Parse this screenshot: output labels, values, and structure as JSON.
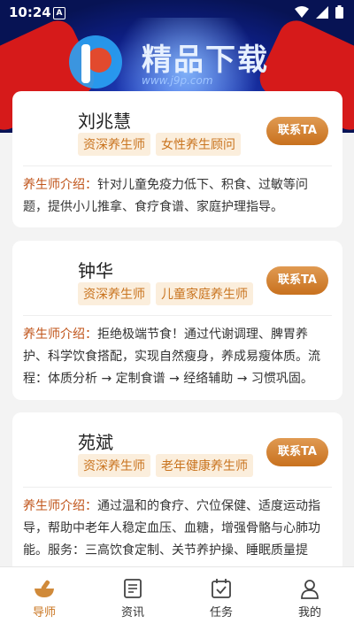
{
  "status": {
    "time": "10:24",
    "a_label": "A"
  },
  "watermark": {
    "text": "精品下载",
    "url": "www.j9p.com"
  },
  "advisors": [
    {
      "name": "刘兆慧",
      "tags": [
        "资深养生师",
        "女性养生顾问"
      ],
      "contact": "联系TA",
      "intro_label": "养生师介绍：",
      "intro": "针对儿童免疫力低下、积食、过敏等问题，提供小儿推拿、食疗食谱、家庭护理指导。"
    },
    {
      "name": "钟华",
      "tags": [
        "资深养生师",
        "儿童家庭养生师"
      ],
      "contact": "联系TA",
      "intro_label": "养生师介绍：",
      "intro": "拒绝极端节食！通过代谢调理、脾胃养护、科学饮食搭配，实现自然瘦身，养成易瘦体质。流程：体质分析 → 定制食谱 → 经络辅助 → 习惯巩固。"
    },
    {
      "name": "苑斌",
      "tags": [
        "资深养生师",
        "老年健康养生师"
      ],
      "contact": "联系TA",
      "intro_label": "养生师介绍：",
      "intro": "通过温和的食疗、穴位保健、适度运动指导，帮助中老年人稳定血压、血糖，增强骨骼与心肺功能。服务：三高饮食定制、关节养护操、睡眠质量提"
    }
  ],
  "tabs": [
    {
      "label": "导师",
      "icon": "mortar-icon",
      "active": true
    },
    {
      "label": "资讯",
      "icon": "news-icon",
      "active": false
    },
    {
      "label": "任务",
      "icon": "calendar-task-icon",
      "active": false
    },
    {
      "label": "我的",
      "icon": "user-icon",
      "active": false
    }
  ],
  "colors": {
    "accent": "#c9741f",
    "tag_bg": "#fbeedc",
    "intro_label": "#c0541a",
    "banner": "#0e1f86"
  }
}
